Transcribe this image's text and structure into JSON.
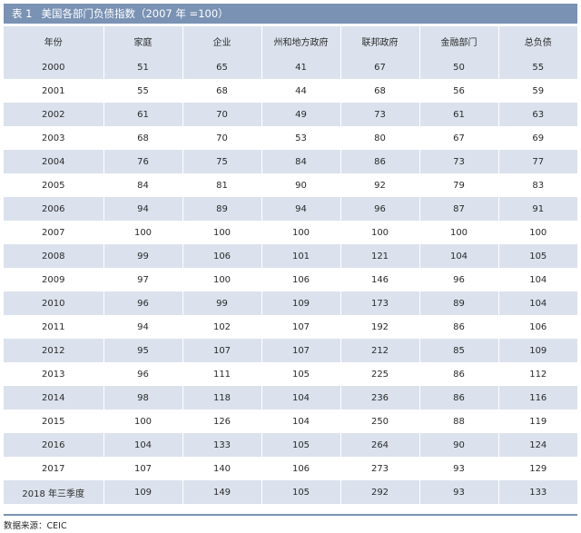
{
  "table": {
    "number": "表 1",
    "title": "美国各部门负债指数（2007 年 =100）",
    "headers": [
      "年份",
      "家庭",
      "企业",
      "州和地方政府",
      "联邦政府",
      "金融部门",
      "总负债"
    ],
    "rows": [
      [
        "2000",
        "51",
        "65",
        "41",
        "67",
        "50",
        "55"
      ],
      [
        "2001",
        "55",
        "68",
        "44",
        "68",
        "56",
        "59"
      ],
      [
        "2002",
        "61",
        "70",
        "49",
        "73",
        "61",
        "63"
      ],
      [
        "2003",
        "68",
        "70",
        "53",
        "80",
        "67",
        "69"
      ],
      [
        "2004",
        "76",
        "75",
        "84",
        "86",
        "73",
        "77"
      ],
      [
        "2005",
        "84",
        "81",
        "90",
        "92",
        "79",
        "83"
      ],
      [
        "2006",
        "94",
        "89",
        "94",
        "96",
        "87",
        "91"
      ],
      [
        "2007",
        "100",
        "100",
        "100",
        "100",
        "100",
        "100"
      ],
      [
        "2008",
        "99",
        "106",
        "101",
        "121",
        "104",
        "105"
      ],
      [
        "2009",
        "97",
        "100",
        "106",
        "146",
        "96",
        "104"
      ],
      [
        "2010",
        "96",
        "99",
        "109",
        "173",
        "89",
        "104"
      ],
      [
        "2011",
        "94",
        "102",
        "107",
        "192",
        "86",
        "106"
      ],
      [
        "2012",
        "95",
        "107",
        "107",
        "212",
        "85",
        "109"
      ],
      [
        "2013",
        "96",
        "111",
        "105",
        "225",
        "86",
        "112"
      ],
      [
        "2014",
        "98",
        "118",
        "104",
        "236",
        "86",
        "116"
      ],
      [
        "2015",
        "100",
        "126",
        "104",
        "250",
        "88",
        "119"
      ],
      [
        "2016",
        "104",
        "133",
        "105",
        "264",
        "90",
        "124"
      ],
      [
        "2017",
        "107",
        "140",
        "106",
        "273",
        "93",
        "129"
      ],
      [
        "2018 年三季度",
        "109",
        "149",
        "105",
        "292",
        "93",
        "133"
      ]
    ]
  },
  "source": "数据来源：CEIC",
  "colors": {
    "caption_bar": "#7a92b4",
    "row_band": "#dbe2ed"
  }
}
